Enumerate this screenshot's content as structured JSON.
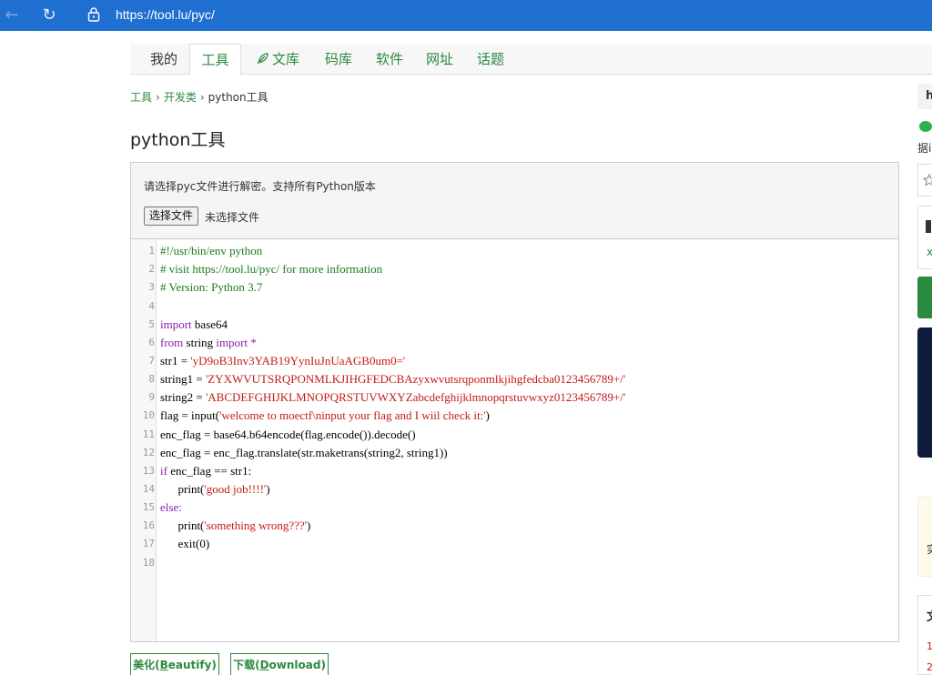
{
  "browser": {
    "url": "https://tool.lu/pyc/",
    "back_icon": "arrow-left-icon",
    "reload_icon": "reload-icon",
    "lock_icon": "site-info-icon"
  },
  "nav": {
    "tabs": [
      {
        "label": "我的"
      },
      {
        "label": "工具"
      },
      {
        "label": "文库"
      },
      {
        "label": "码库"
      },
      {
        "label": "软件"
      },
      {
        "label": "网址"
      },
      {
        "label": "话题"
      }
    ]
  },
  "breadcrumb": {
    "items": [
      "工具",
      "开发类",
      "python工具"
    ],
    "separator": "›"
  },
  "page_title": "python工具",
  "panel": {
    "hint": "请选择pyc文件进行解密。支持所有Python版本",
    "file_button": "选择文件",
    "file_status": "未选择文件"
  },
  "code": {
    "line_numbers": [
      "1",
      "2",
      "3",
      "4",
      "5",
      "6",
      "7",
      "8",
      "9",
      "10",
      "11",
      "12",
      "13",
      "14",
      "15",
      "16",
      "17",
      "18"
    ],
    "l1": "#!/usr/bin/env python",
    "l2": "# visit https://tool.lu/pyc/ for more information",
    "l3": "# Version: Python 3.7",
    "l5_kw": "import",
    "l5_rest": " base64",
    "l6_kw1": "from",
    "l6_mid": " string ",
    "l6_kw2": "import",
    "l6_op": " *",
    "l7_a": "str1 = ",
    "l7_s": "'yD9oB3Inv3YAB19YynIuJnUaAGB0um0='",
    "l8_a": "string1 = ",
    "l8_s": "'ZYXWVUTSRQPONMLKJIHGFEDCBAzyxwvutsrqponmlkjihgfedcba0123456789+/'",
    "l9_a": "string2 = ",
    "l9_s": "'ABCDEFGHIJKLMNOPQRSTUVWXYZabcdefghijklmnopqrstuvwxyz0123456789+/'",
    "l10_a": "flag = input(",
    "l10_s": "'welcome to moectf\\ninput your flag and I wiil check it:'",
    "l10_b": ")",
    "l11": "enc_flag = base64.b64encode(flag.encode()).decode()",
    "l12": "enc_flag = enc_flag.translate(str.maketrans(string2, string1))",
    "l13_kw": "if",
    "l13_rest": " enc_flag == str1:",
    "l14_a": "      print(",
    "l14_s": "'good job!!!!'",
    "l14_b": ")",
    "l15": "else:",
    "l16_a": "      print(",
    "l16_s": "'something wrong???'",
    "l16_b": ")",
    "l17": "      exit(0)"
  },
  "actions": {
    "beautify_pre": "美化(",
    "beautify_key": "B",
    "beautify_post": "eautify)",
    "download_pre": "下载(",
    "download_key": "D",
    "download_post": "ownload)"
  },
  "right_fragments": {
    "a": "h",
    "b": "据i",
    "c": "x",
    "d": "实",
    "e": "文",
    "f": "1",
    "g": "2"
  },
  "colors": {
    "browser_bar": "#1f6fd1",
    "accent_green": "#2a8a3e",
    "dark_navy": "#0e1a3a"
  }
}
